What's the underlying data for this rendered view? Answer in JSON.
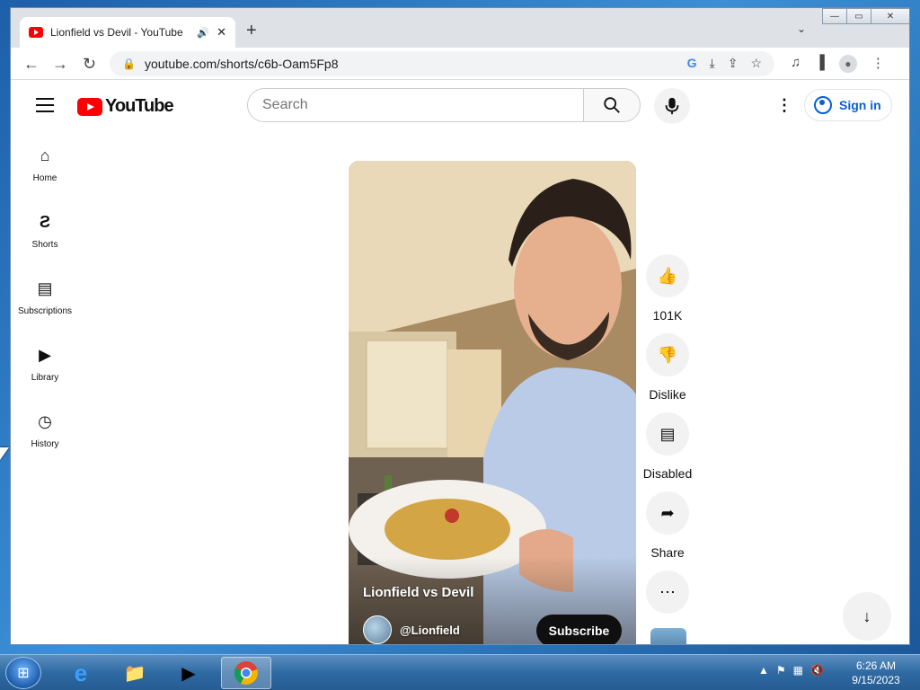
{
  "browser": {
    "tab_title": "Lionfield vs Devil - YouTube",
    "url": "youtube.com/shorts/c6b-Oam5Fp8"
  },
  "youtube": {
    "logo_text": "YouTube",
    "search_placeholder": "Search",
    "sign_in": "Sign in",
    "guide": [
      {
        "label": "Home",
        "icon": "home-icon"
      },
      {
        "label": "Shorts",
        "icon": "shorts-icon"
      },
      {
        "label": "Subscriptions",
        "icon": "subscriptions-icon"
      },
      {
        "label": "Library",
        "icon": "library-icon"
      },
      {
        "label": "History",
        "icon": "history-icon"
      }
    ],
    "short": {
      "title": "Lionfield vs Devil",
      "channel": "@Lionfield",
      "subscribe": "Subscribe"
    },
    "actions": {
      "like_count": "101K",
      "dislike": "Dislike",
      "comments": "Disabled",
      "share": "Share"
    }
  },
  "taskbar": {
    "time": "6:26 AM",
    "date": "9/15/2023"
  }
}
